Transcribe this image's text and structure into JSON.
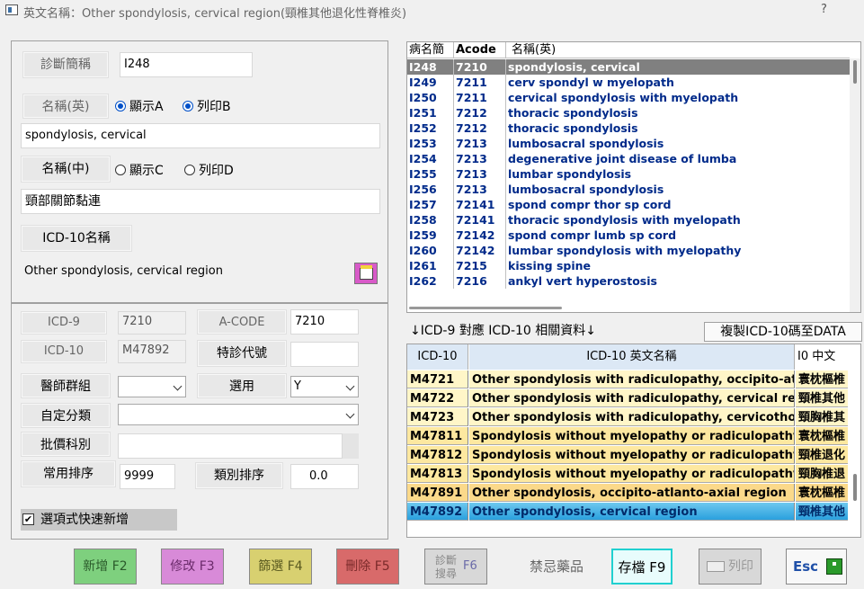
{
  "window": {
    "title": "英文名稱：Other spondylosis, cervical region(頸椎其他退化性脊椎炎)",
    "help": "?"
  },
  "form": {
    "diag_short_label": "診斷簡稱",
    "diag_short_value": "I248",
    "name_en_label": "名稱(英)",
    "show_a": "顯示A",
    "print_b": "列印B",
    "name_en_value": "spondylosis, cervical",
    "name_zh_label": "名稱(中)",
    "show_c": "顯示C",
    "print_d": "列印D",
    "name_zh_value": "頸部關節黏連",
    "icd10_name_label": "ICD-10名稱",
    "icd10_name_value": "Other spondylosis, cervical region",
    "icd9_label": "ICD-9",
    "icd9_value": "7210",
    "acode_label": "A-CODE",
    "acode_value": "7210",
    "icd10_label": "ICD-10",
    "icd10_value": "M47892",
    "special_code_label": "特診代號",
    "special_code_value": "",
    "doctor_group_label": "醫師群組",
    "doctor_group_value": "",
    "select_label": "選用",
    "select_value": "Y",
    "custom_class_label": "自定分類",
    "custom_class_value": "",
    "price_dept_label": "批價科別",
    "price_dept_value": "",
    "common_order_label": "常用排序",
    "common_order_value": "9999",
    "class_order_label": "類別排序",
    "class_order_value": "0.0",
    "quick_add_label": "選項式快速新增",
    "quick_add_checked": "✔"
  },
  "table1": {
    "headers": [
      "病名簡",
      "Acode",
      "名稱(英)"
    ],
    "rows": [
      [
        "I248",
        "7210",
        "spondylosis, cervical"
      ],
      [
        "I249",
        "7211",
        "cerv spondyl w myelopath"
      ],
      [
        "I250",
        "7211",
        "cervical spondylosis with myelopath"
      ],
      [
        "I251",
        "7212",
        "thoracic spondylosis"
      ],
      [
        "I252",
        "7212",
        "thoracic spondylosis"
      ],
      [
        "I253",
        "7213",
        "lumbosacral spondylosis"
      ],
      [
        "I254",
        "7213",
        "degenerative joint disease of lumba"
      ],
      [
        "I255",
        "7213",
        "lumbar spondylosis"
      ],
      [
        "I256",
        "7213",
        "lumbosacral spondylosis"
      ],
      [
        "I257",
        "72141",
        "spond compr thor sp cord"
      ],
      [
        "I258",
        "72141",
        "thoracic spondylosis with myelopath"
      ],
      [
        "I259",
        "72142",
        "spond compr lumb sp cord"
      ],
      [
        "I260",
        "72142",
        "lumbar spondylosis with myelopathy"
      ],
      [
        "I261",
        "7215",
        "kissing spine"
      ],
      [
        "I262",
        "7216",
        "ankyl vert hyperostosis"
      ]
    ]
  },
  "mapping": {
    "label": "↓ICD-9 對應 ICD-10 相關資料↓",
    "copy_button": "複製ICD-10碼至DATA"
  },
  "table2": {
    "headers": [
      "ICD-10",
      "ICD-10 英文名稱",
      "I0 中文"
    ],
    "rows": [
      [
        "M4721",
        "Other spondylosis with radiculopathy, occipito-atlanto-axial region",
        "寰枕樞椎"
      ],
      [
        "M4722",
        "Other spondylosis with radiculopathy, cervical region",
        "頸椎其他"
      ],
      [
        "M4723",
        "Other spondylosis with radiculopathy, cervicothoracic region",
        "頸胸椎其"
      ],
      [
        "M47811",
        "Spondylosis without myelopathy or radiculopathy, occipito-atlanto-axial region",
        "寰枕樞椎"
      ],
      [
        "M47812",
        "Spondylosis without myelopathy or radiculopathy, cervical region",
        "頸椎退化"
      ],
      [
        "M47813",
        "Spondylosis without myelopathy or radiculopathy, cervicothoracic region",
        "頸胸椎退"
      ],
      [
        "M47891",
        "Other spondylosis, occipito-atlanto-axial region",
        "寰枕樞椎"
      ],
      [
        "M47892",
        "Other spondylosis, cervical region",
        "頸椎其他"
      ]
    ]
  },
  "toolbar": {
    "add": "新增 F2",
    "edit": "修改 F3",
    "filter": "篩選 F4",
    "delete": "刪除 F5",
    "f6_line1": "診斷",
    "f6_line2": "搜尋",
    "f6_key": "F6",
    "forbidden": "禁忌藥品",
    "save": "存檔 F9",
    "print": "列印",
    "esc": "Esc"
  }
}
